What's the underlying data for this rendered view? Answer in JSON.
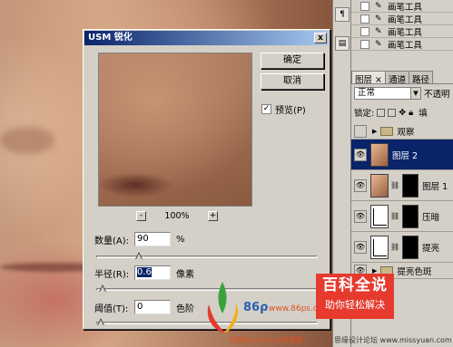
{
  "history_panel": {
    "items": [
      {
        "label": "画笔工具"
      },
      {
        "label": "画笔工具"
      },
      {
        "label": "画笔工具"
      },
      {
        "label": "画笔工具"
      }
    ]
  },
  "layers_panel": {
    "tabs": [
      {
        "label": "图层 ×"
      },
      {
        "label": "通道"
      },
      {
        "label": "路径"
      }
    ],
    "blend_mode": "正常",
    "opacity_label": "不透明",
    "lock_label": "锁定:",
    "fill_label": "填",
    "layers": [
      {
        "name": "观察",
        "kind": "group"
      },
      {
        "name": "图层 2",
        "kind": "layer",
        "selected": true
      },
      {
        "name": "图层 1",
        "kind": "layer_masked"
      },
      {
        "name": "压暗",
        "kind": "curves"
      },
      {
        "name": "提亮",
        "kind": "curves"
      },
      {
        "name": "提亮色斑",
        "kind": "group"
      }
    ]
  },
  "dialog": {
    "title": "USM 锐化",
    "close_label": "x",
    "ok_label": "确定",
    "cancel_label": "取消",
    "preview_label": "预览(P)",
    "preview_checked": true,
    "zoom_out_label": "-",
    "zoom_in_label": "+",
    "zoom_level": "100%",
    "amount": {
      "label": "数量(A):",
      "value": "90",
      "unit": "%",
      "slider_fraction": 0.18
    },
    "radius": {
      "label": "半径(R):",
      "value": "0.6",
      "unit": "像素",
      "slider_fraction": 0.01
    },
    "threshold": {
      "label": "阈值(T):",
      "value": "0",
      "unit": "色阶",
      "slider_fraction": 0.0
    }
  },
  "watermarks": {
    "baike_title": "百科全说",
    "baike_sub": "助你轻松解决",
    "site_86": "www.86ps.com",
    "site_cn": "中国Photoshop资源网",
    "missyuan": "思缘设计论坛 www.missyuan.com"
  },
  "colors": {
    "title_bar_start": "#0a246a",
    "title_bar_end": "#a6caf0",
    "dialog_face": "#d4d0c8",
    "selected_layer": "#0a246a",
    "watermark_red": "#e53a2d"
  }
}
